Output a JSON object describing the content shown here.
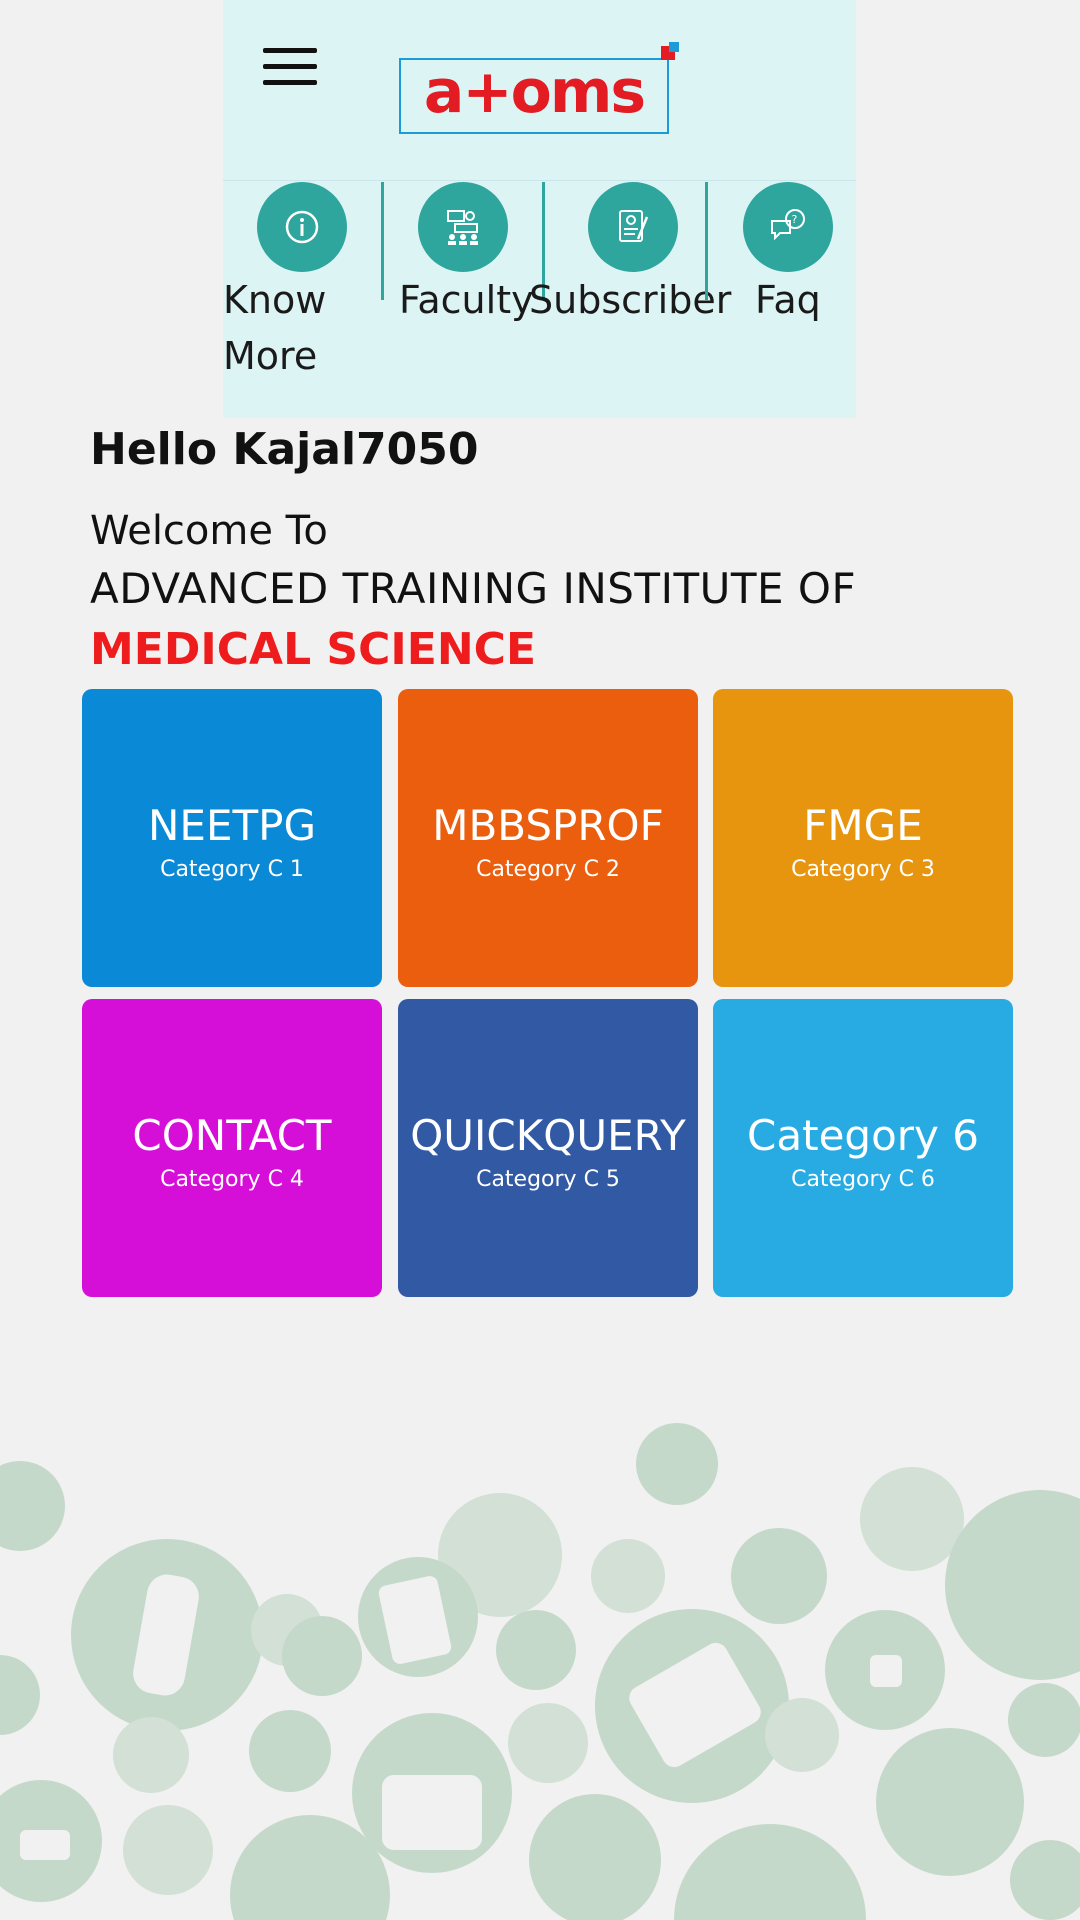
{
  "header": {
    "logo_text": "a+oms",
    "colors": {
      "background": "#ddf4f5",
      "accent": "#2ea59d",
      "logo_red": "#e31b23",
      "logo_blue": "#1b9bd7"
    }
  },
  "nav": [
    {
      "label": "Know\nMore",
      "icon": "info-icon"
    },
    {
      "label": "Faculty",
      "icon": "faculty-icon"
    },
    {
      "label": "Subscriber",
      "icon": "subscriber-icon"
    },
    {
      "label": "Faq",
      "icon": "faq-icon"
    }
  ],
  "main": {
    "greeting": "Hello Kajal7050",
    "welcome": "Welcome To",
    "institute_line1": "ADVANCED TRAINING INSTITUTE OF",
    "institute_line2": "MEDICAL SCIENCE"
  },
  "tiles": [
    {
      "title": "NEETPG",
      "subtitle": "Category C 1",
      "color": "#0a89d6"
    },
    {
      "title": "MBBSPROF",
      "subtitle": "Category C 2",
      "color": "#ea5e0e"
    },
    {
      "title": "FMGE",
      "subtitle": "Category C 3",
      "color": "#e7950f"
    },
    {
      "title": "CONTACT",
      "subtitle": "Category C 4",
      "color": "#d60fd8"
    },
    {
      "title": "QUICKQUERY",
      "subtitle": "Category C 5",
      "color": "#3259a4"
    },
    {
      "title": "Category 6",
      "subtitle": "Category C 6",
      "color": "#28abe3"
    }
  ]
}
